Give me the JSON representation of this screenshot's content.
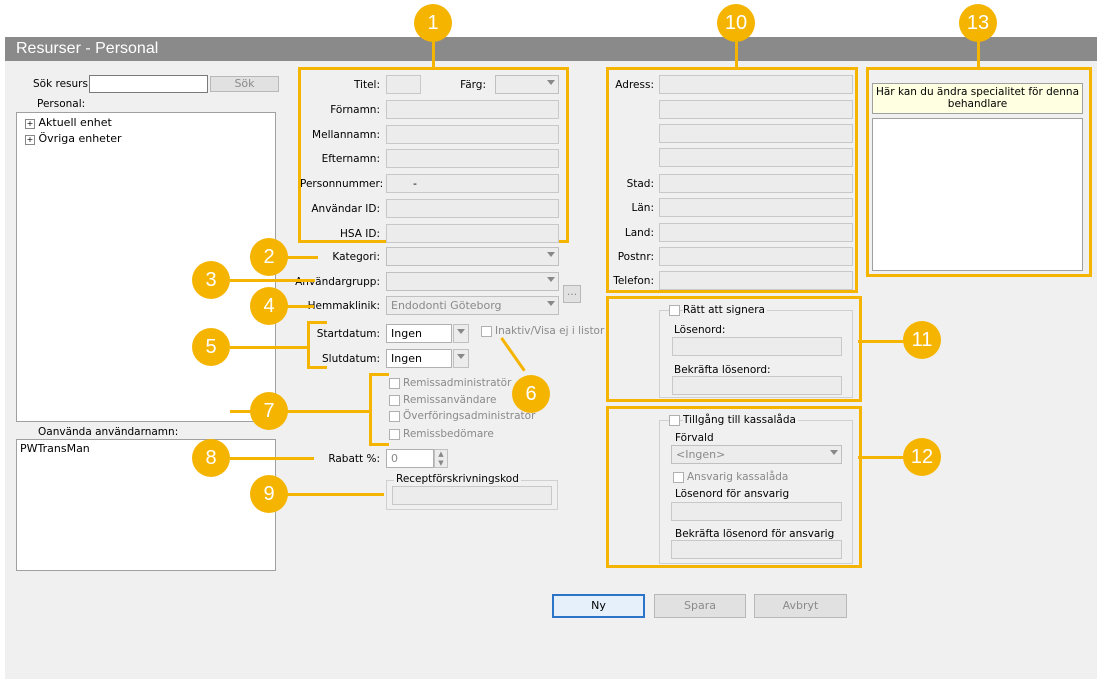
{
  "window": {
    "title": "Resurser - Personal"
  },
  "search": {
    "label": "Sök resurs:",
    "value": "",
    "button": "Sök"
  },
  "personal": {
    "label": "Personal:",
    "tree": [
      "Aktuell enhet",
      "Övriga enheter"
    ]
  },
  "unused": {
    "label": "Oanvända användarnamn:",
    "items": [
      "PWTransMan"
    ]
  },
  "person": {
    "titel": "Titel:",
    "farg": "Färg:",
    "fornamn": "Förnamn:",
    "mellannamn": "Mellannamn:",
    "efternamn": "Efternamn:",
    "personnummer": "Personnummer:",
    "personnummer_value": "-",
    "anvandar_id": "Användar ID:",
    "hsa_id": "HSA ID:"
  },
  "form": {
    "kategori": "Kategori:",
    "anvandargrupp": "Användargrupp:",
    "hemmaklinik": "Hemmaklinik:",
    "hemmaklinik_value": "Endodonti Göteborg",
    "ellipsis": "...",
    "startdatum": "Startdatum:",
    "startdatum_value": "Ingen",
    "slutdatum": "Slutdatum:",
    "slutdatum_value": "Ingen",
    "inaktiv": "Inaktiv/Visa ej i listor",
    "roles": [
      "Remissadministratör",
      "Remissanvändare",
      "Överföringsadministratör",
      "Remissbedömare"
    ],
    "rabatt": "Rabatt %:",
    "rabatt_value": "0",
    "recept": "Receptförskrivningskod"
  },
  "address": {
    "adress": "Adress:",
    "stad": "Stad:",
    "lan": "Län:",
    "land": "Land:",
    "postnr": "Postnr:",
    "telefon": "Telefon:"
  },
  "sign": {
    "ratt": "Rätt att signera",
    "losenord": "Lösenord:",
    "bekrafta": "Bekräfta lösenord:"
  },
  "kassa": {
    "tillgang": "Tillgång till kassalåda",
    "forvald": "Förvald",
    "forvald_value": "<Ingen>",
    "ansvarig": "Ansvarig kassalåda",
    "losen_ansvarig": "Lösenord för ansvarig",
    "bekrafta_ansvarig": "Bekräfta lösenord för ansvarig"
  },
  "specialitet": {
    "info": "Här kan du ändra specialitet för denna behandlare"
  },
  "buttons": {
    "ny": "Ny",
    "spara": "Spara",
    "avbryt": "Avbryt"
  },
  "callouts": [
    "1",
    "2",
    "3",
    "4",
    "5",
    "6",
    "7",
    "8",
    "9",
    "10",
    "11",
    "12",
    "13"
  ],
  "colors": {
    "callout": "#f5b400",
    "primary_border": "#2b74c8"
  }
}
